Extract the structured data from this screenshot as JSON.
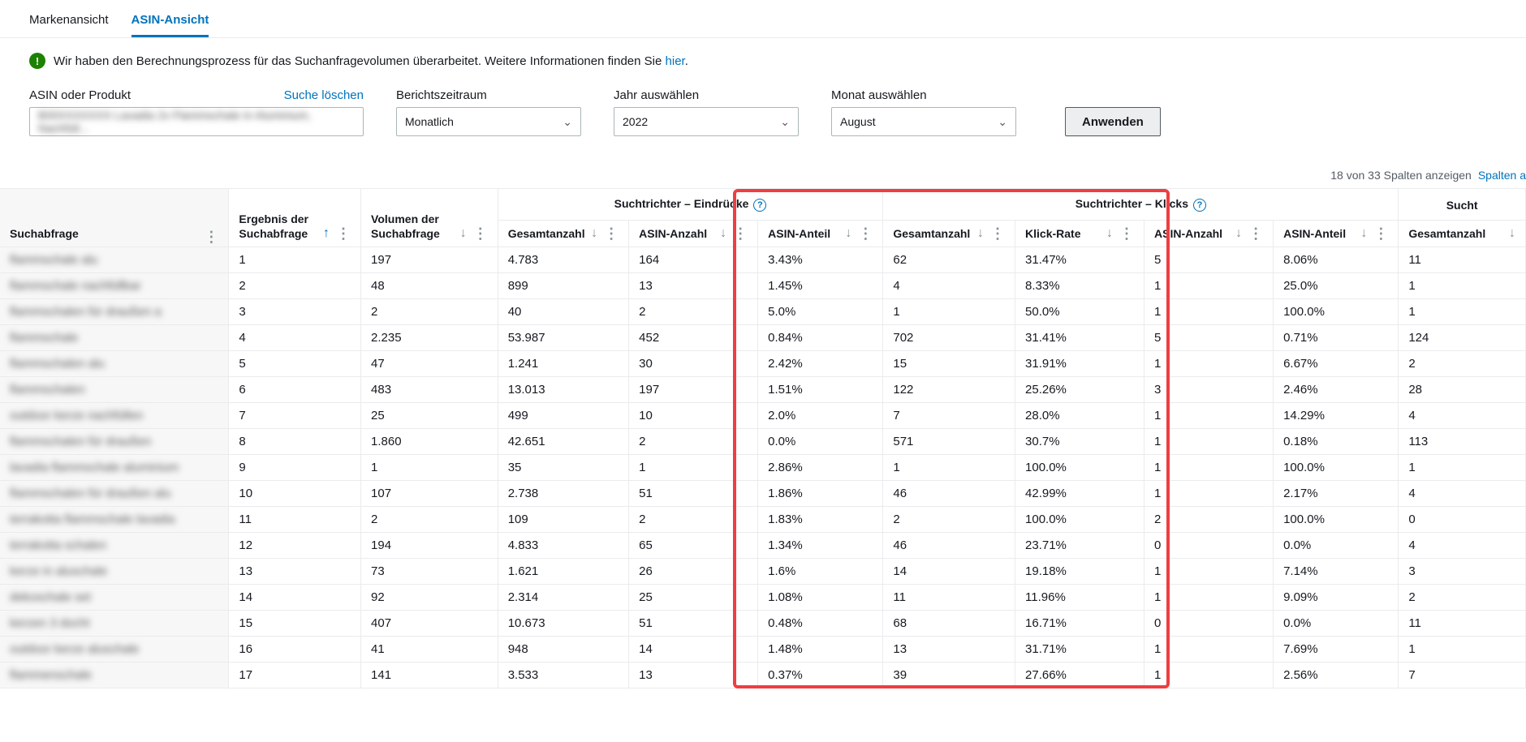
{
  "tabs": {
    "brand": "Markenansicht",
    "asin": "ASIN-Ansicht"
  },
  "notice": {
    "text": "Wir haben den Berechnungsprozess für das Suchanfragevolumen überarbeitet. Weitere Informationen finden Sie ",
    "link": "hier"
  },
  "filters": {
    "asin_label": "ASIN oder Produkt",
    "clear": "Suche löschen",
    "asin_value": "B00XXXXXXX Lavadia 2x Flammschale in Aluminium, Nachfüll...",
    "period_label": "Berichtszeitraum",
    "period_value": "Monatlich",
    "year_label": "Jahr auswählen",
    "year_value": "2022",
    "month_label": "Monat auswählen",
    "month_value": "August",
    "apply": "Anwenden"
  },
  "cols_info": {
    "count": "18 von 33 Spalten anzeigen",
    "link": "Spalten a"
  },
  "groups": {
    "impressions": "Suchtrichter – Eindrücke",
    "clicks": "Suchtrichter – Klicks",
    "next": "Sucht"
  },
  "headers": {
    "query": "Suchabfrage",
    "rank": "Ergebnis der Suchabfrage",
    "vol": "Volumen der Suchabfrage",
    "total": "Gesamtanzahl",
    "asin_count": "ASIN-Anzahl",
    "asin_share": "ASIN-Anteil",
    "click_rate": "Klick-Rate"
  },
  "rows": [
    {
      "q": "flammschale alu",
      "rank": "1",
      "vol": "197",
      "i_total": "4.783",
      "i_asin": "164",
      "i_share": "3.43%",
      "c_total": "62",
      "c_rate": "31.47%",
      "c_asin": "5",
      "c_share": "8.06%",
      "n": "11"
    },
    {
      "q": "flammschale nachfüllbar",
      "rank": "2",
      "vol": "48",
      "i_total": "899",
      "i_asin": "13",
      "i_share": "1.45%",
      "c_total": "4",
      "c_rate": "8.33%",
      "c_asin": "1",
      "c_share": "25.0%",
      "n": "1"
    },
    {
      "q": "flammschalen für draußen a",
      "rank": "3",
      "vol": "2",
      "i_total": "40",
      "i_asin": "2",
      "i_share": "5.0%",
      "c_total": "1",
      "c_rate": "50.0%",
      "c_asin": "1",
      "c_share": "100.0%",
      "n": "1"
    },
    {
      "q": "flammschale",
      "rank": "4",
      "vol": "2.235",
      "i_total": "53.987",
      "i_asin": "452",
      "i_share": "0.84%",
      "c_total": "702",
      "c_rate": "31.41%",
      "c_asin": "5",
      "c_share": "0.71%",
      "n": "124"
    },
    {
      "q": "flammschalen alu",
      "rank": "5",
      "vol": "47",
      "i_total": "1.241",
      "i_asin": "30",
      "i_share": "2.42%",
      "c_total": "15",
      "c_rate": "31.91%",
      "c_asin": "1",
      "c_share": "6.67%",
      "n": "2"
    },
    {
      "q": "flammschalen",
      "rank": "6",
      "vol": "483",
      "i_total": "13.013",
      "i_asin": "197",
      "i_share": "1.51%",
      "c_total": "122",
      "c_rate": "25.26%",
      "c_asin": "3",
      "c_share": "2.46%",
      "n": "28"
    },
    {
      "q": "outdoor kerze nachfüllen",
      "rank": "7",
      "vol": "25",
      "i_total": "499",
      "i_asin": "10",
      "i_share": "2.0%",
      "c_total": "7",
      "c_rate": "28.0%",
      "c_asin": "1",
      "c_share": "14.29%",
      "n": "4"
    },
    {
      "q": "flammschalen für draußen",
      "rank": "8",
      "vol": "1.860",
      "i_total": "42.651",
      "i_asin": "2",
      "i_share": "0.0%",
      "c_total": "571",
      "c_rate": "30.7%",
      "c_asin": "1",
      "c_share": "0.18%",
      "n": "113"
    },
    {
      "q": "lavadia flammschale aluminium",
      "rank": "9",
      "vol": "1",
      "i_total": "35",
      "i_asin": "1",
      "i_share": "2.86%",
      "c_total": "1",
      "c_rate": "100.0%",
      "c_asin": "1",
      "c_share": "100.0%",
      "n": "1"
    },
    {
      "q": "flammschalen für draußen alu",
      "rank": "10",
      "vol": "107",
      "i_total": "2.738",
      "i_asin": "51",
      "i_share": "1.86%",
      "c_total": "46",
      "c_rate": "42.99%",
      "c_asin": "1",
      "c_share": "2.17%",
      "n": "4"
    },
    {
      "q": "terrakotta flammschale lavadia",
      "rank": "11",
      "vol": "2",
      "i_total": "109",
      "i_asin": "2",
      "i_share": "1.83%",
      "c_total": "2",
      "c_rate": "100.0%",
      "c_asin": "2",
      "c_share": "100.0%",
      "n": "0"
    },
    {
      "q": "terrakotta schalen",
      "rank": "12",
      "vol": "194",
      "i_total": "4.833",
      "i_asin": "65",
      "i_share": "1.34%",
      "c_total": "46",
      "c_rate": "23.71%",
      "c_asin": "0",
      "c_share": "0.0%",
      "n": "4"
    },
    {
      "q": "kerze in aluschale",
      "rank": "13",
      "vol": "73",
      "i_total": "1.621",
      "i_asin": "26",
      "i_share": "1.6%",
      "c_total": "14",
      "c_rate": "19.18%",
      "c_asin": "1",
      "c_share": "7.14%",
      "n": "3"
    },
    {
      "q": "dekoschale set",
      "rank": "14",
      "vol": "92",
      "i_total": "2.314",
      "i_asin": "25",
      "i_share": "1.08%",
      "c_total": "11",
      "c_rate": "11.96%",
      "c_asin": "1",
      "c_share": "9.09%",
      "n": "2"
    },
    {
      "q": "kerzen 3 docht",
      "rank": "15",
      "vol": "407",
      "i_total": "10.673",
      "i_asin": "51",
      "i_share": "0.48%",
      "c_total": "68",
      "c_rate": "16.71%",
      "c_asin": "0",
      "c_share": "0.0%",
      "n": "11"
    },
    {
      "q": "outdoor kerze aluschale",
      "rank": "16",
      "vol": "41",
      "i_total": "948",
      "i_asin": "14",
      "i_share": "1.48%",
      "c_total": "13",
      "c_rate": "31.71%",
      "c_asin": "1",
      "c_share": "7.69%",
      "n": "1"
    },
    {
      "q": "flammenschale",
      "rank": "17",
      "vol": "141",
      "i_total": "3.533",
      "i_asin": "13",
      "i_share": "0.37%",
      "c_total": "39",
      "c_rate": "27.66%",
      "c_asin": "1",
      "c_share": "2.56%",
      "n": "7"
    }
  ]
}
